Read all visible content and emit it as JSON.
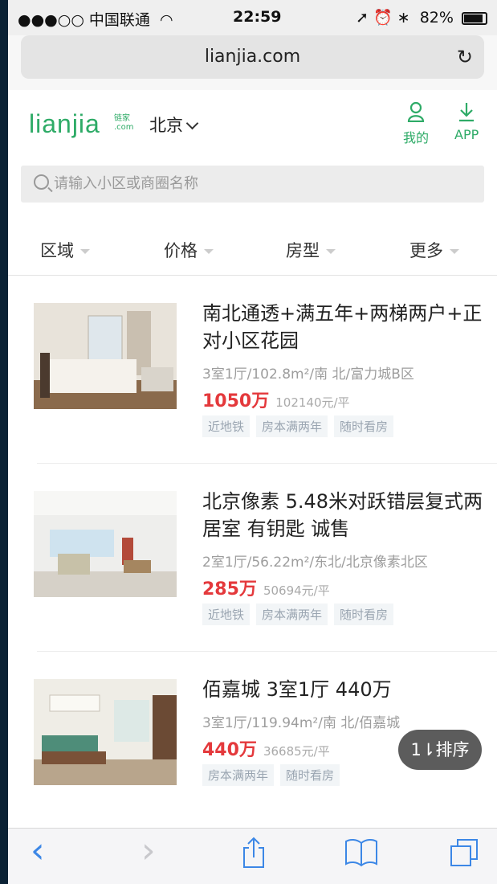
{
  "status_bar": {
    "carrier": "●●●○○ 中国联通",
    "wifi_icon": "wifi-icon",
    "time": "22:59",
    "right_icons": "➚ ⏰ ∗",
    "battery": "82%",
    "battery_level": 0.82
  },
  "browser": {
    "url": "lianjia.com",
    "reload_glyph": "↻"
  },
  "header": {
    "logo": "lianjia",
    "logo_sub_1": "链家",
    "logo_sub_2": ".com",
    "city": "北京",
    "me_label": "我的",
    "me_icon": "person-icon",
    "app_label": "APP",
    "app_icon": "download-icon"
  },
  "search": {
    "placeholder": "请输入小区或商圈名称"
  },
  "filters": [
    "区域",
    "价格",
    "房型",
    "更多"
  ],
  "listings": [
    {
      "title": "南北通透+满五年+两梯两户+正对小区花园",
      "meta": "3室1厅/102.8m²/南 北/富力城B区",
      "total": "1050万",
      "unit_price": "102140元/平",
      "tags": [
        "近地铁",
        "房本满两年",
        "随时看房"
      ]
    },
    {
      "title": "北京像素 5.48米对跃错层复式两居室 有钥匙 诚售",
      "meta": "2室1厅/56.22m²/东北/北京像素北区",
      "total": "285万",
      "unit_price": "50694元/平",
      "tags": [
        "近地铁",
        "房本满两年",
        "随时看房"
      ]
    },
    {
      "title": "佰嘉城 3室1厅 440万",
      "meta": "3室1厅/119.94m²/南 北/佰嘉城",
      "total": "440万",
      "unit_price": "36685元/平",
      "tags": [
        "房本满两年",
        "随时看房"
      ]
    }
  ],
  "sort_button": "1⇂排序",
  "toolbar": {
    "back": "‹",
    "forward": "›",
    "share_icon": "share-icon",
    "bookmarks_icon": "bookmarks-icon",
    "tabs_icon": "tabs-icon"
  },
  "colors": {
    "brand": "#2eab67",
    "price": "#e4393c",
    "ios_blue": "#3c87e6"
  }
}
